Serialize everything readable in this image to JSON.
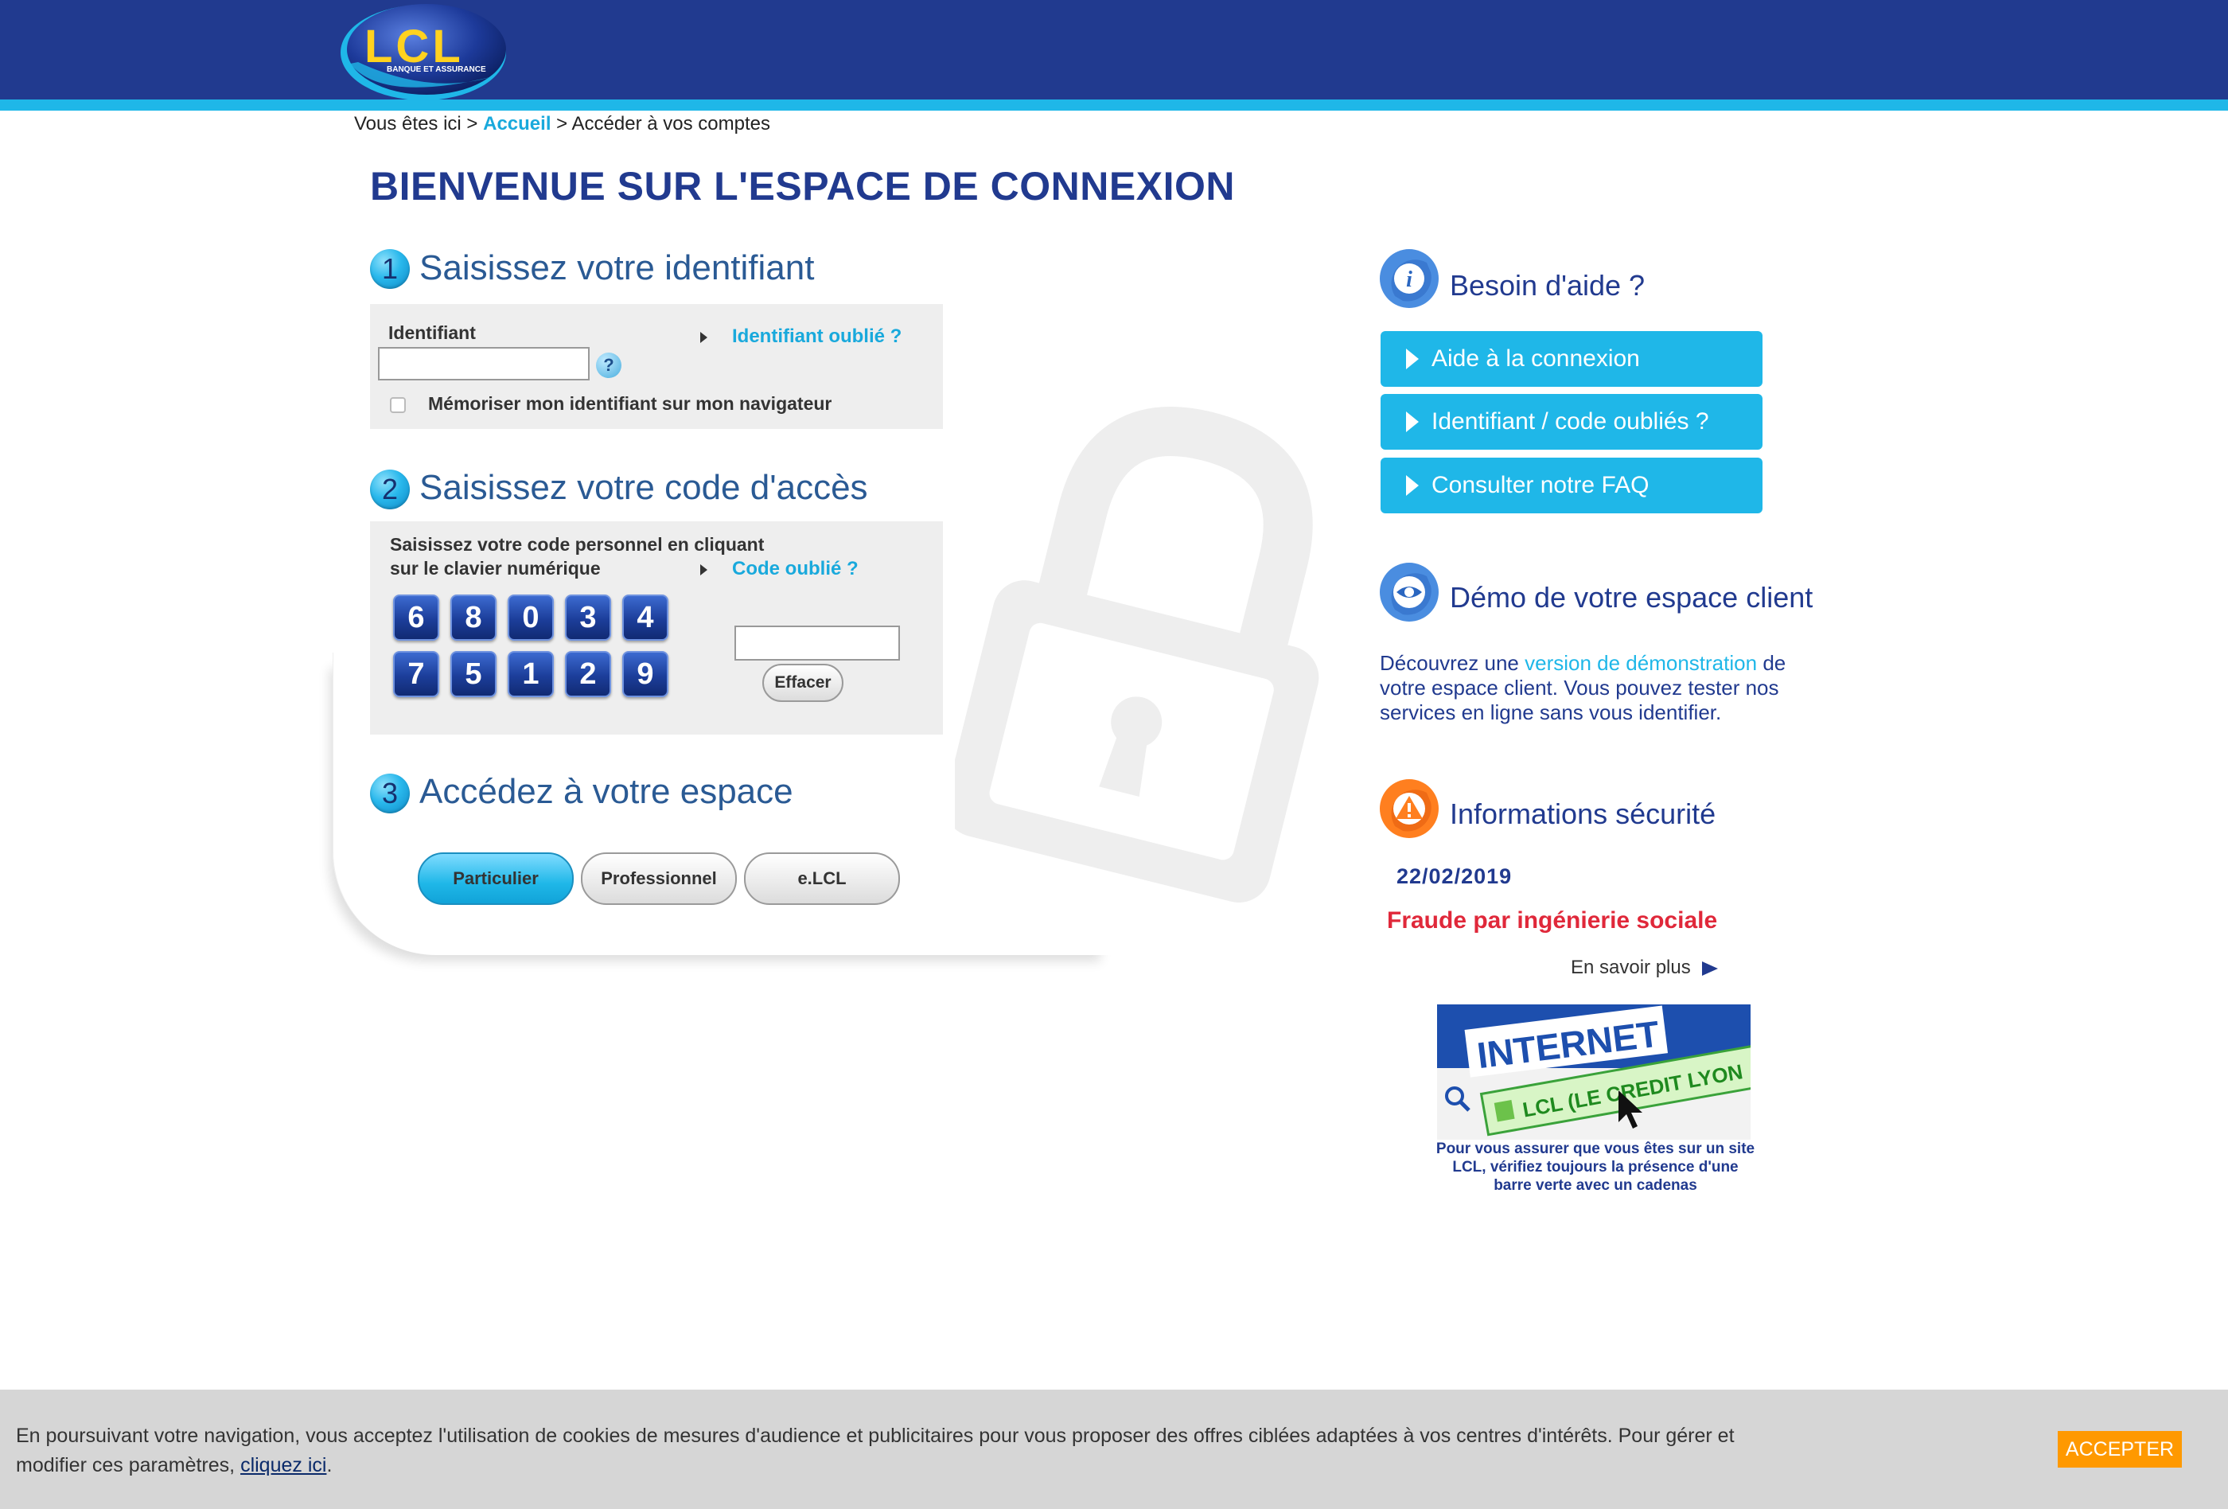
{
  "header": {
    "logo_text": "LCL",
    "logo_subtext": "BANQUE ET ASSURANCE"
  },
  "breadcrumb": {
    "prefix": "Vous êtes ici >",
    "home": "Accueil",
    "current": "> Accéder à vos comptes"
  },
  "page_title": "BIENVENUE SUR L'ESPACE DE CONNEXION",
  "step1": {
    "number": "1",
    "title": "Saisissez votre identifiant",
    "field_label": "Identifiant",
    "field_value": "",
    "help_icon": "question-icon",
    "forgot_link": "Identifiant oublié ?",
    "remember_label": "Mémoriser mon identifiant sur mon navigateur",
    "remember_checked": false
  },
  "step2": {
    "number": "2",
    "title": "Saisissez votre code d'accès",
    "instruction_line1": "Saisissez votre code personnel en cliquant",
    "instruction_line2": "sur le clavier numérique",
    "forgot_link": "Code oublié ?",
    "keys_row1": [
      "6",
      "8",
      "0",
      "3",
      "4"
    ],
    "keys_row2": [
      "7",
      "5",
      "1",
      "2",
      "9"
    ],
    "code_value": "",
    "clear_button": "Effacer"
  },
  "step3": {
    "number": "3",
    "title": "Accédez à votre espace",
    "buttons": [
      "Particulier",
      "Professionnel",
      "e.LCL"
    ],
    "active_button": "Particulier"
  },
  "sidebar": {
    "help": {
      "icon": "info-icon",
      "title": "Besoin d'aide ?",
      "buttons": [
        "Aide à la connexion",
        "Identifiant / code oubliés ?",
        "Consulter notre FAQ"
      ]
    },
    "demo": {
      "icon": "eye-icon",
      "title": "Démo de votre espace client",
      "text_before": "Découvrez une",
      "link": "version de démonstration",
      "text_after": "de votre espace client. Vous pouvez tester nos services en ligne sans vous identifier."
    },
    "security": {
      "icon": "warning-icon",
      "title": "Informations sécurité",
      "date": "22/02/2019",
      "headline": "Fraude par ingénierie sociale",
      "more_link": "En savoir plus",
      "image_title": "INTERNET",
      "image_url_bar": "LCL (LE CREDIT LYON",
      "image_caption": "Pour vous assurer que vous êtes sur un site LCL, vérifiez toujours la présence d'une barre verte avec un cadenas"
    }
  },
  "cookie_bar": {
    "text": "En poursuivant votre navigation, vous acceptez l'utilisation de cookies de mesures d'audience et publicitaires pour vous proposer des offres ciblées adaptées à vos centres d'intérêts. Pour gérer et modifier ces paramètres,",
    "link": "cliquez ici",
    "accept_button": "ACCEPTER"
  },
  "colors": {
    "brand_blue": "#213a8f",
    "accent_cyan": "#1fb7e8",
    "alert_red": "#e0283a",
    "accept_orange": "#ff9900"
  }
}
